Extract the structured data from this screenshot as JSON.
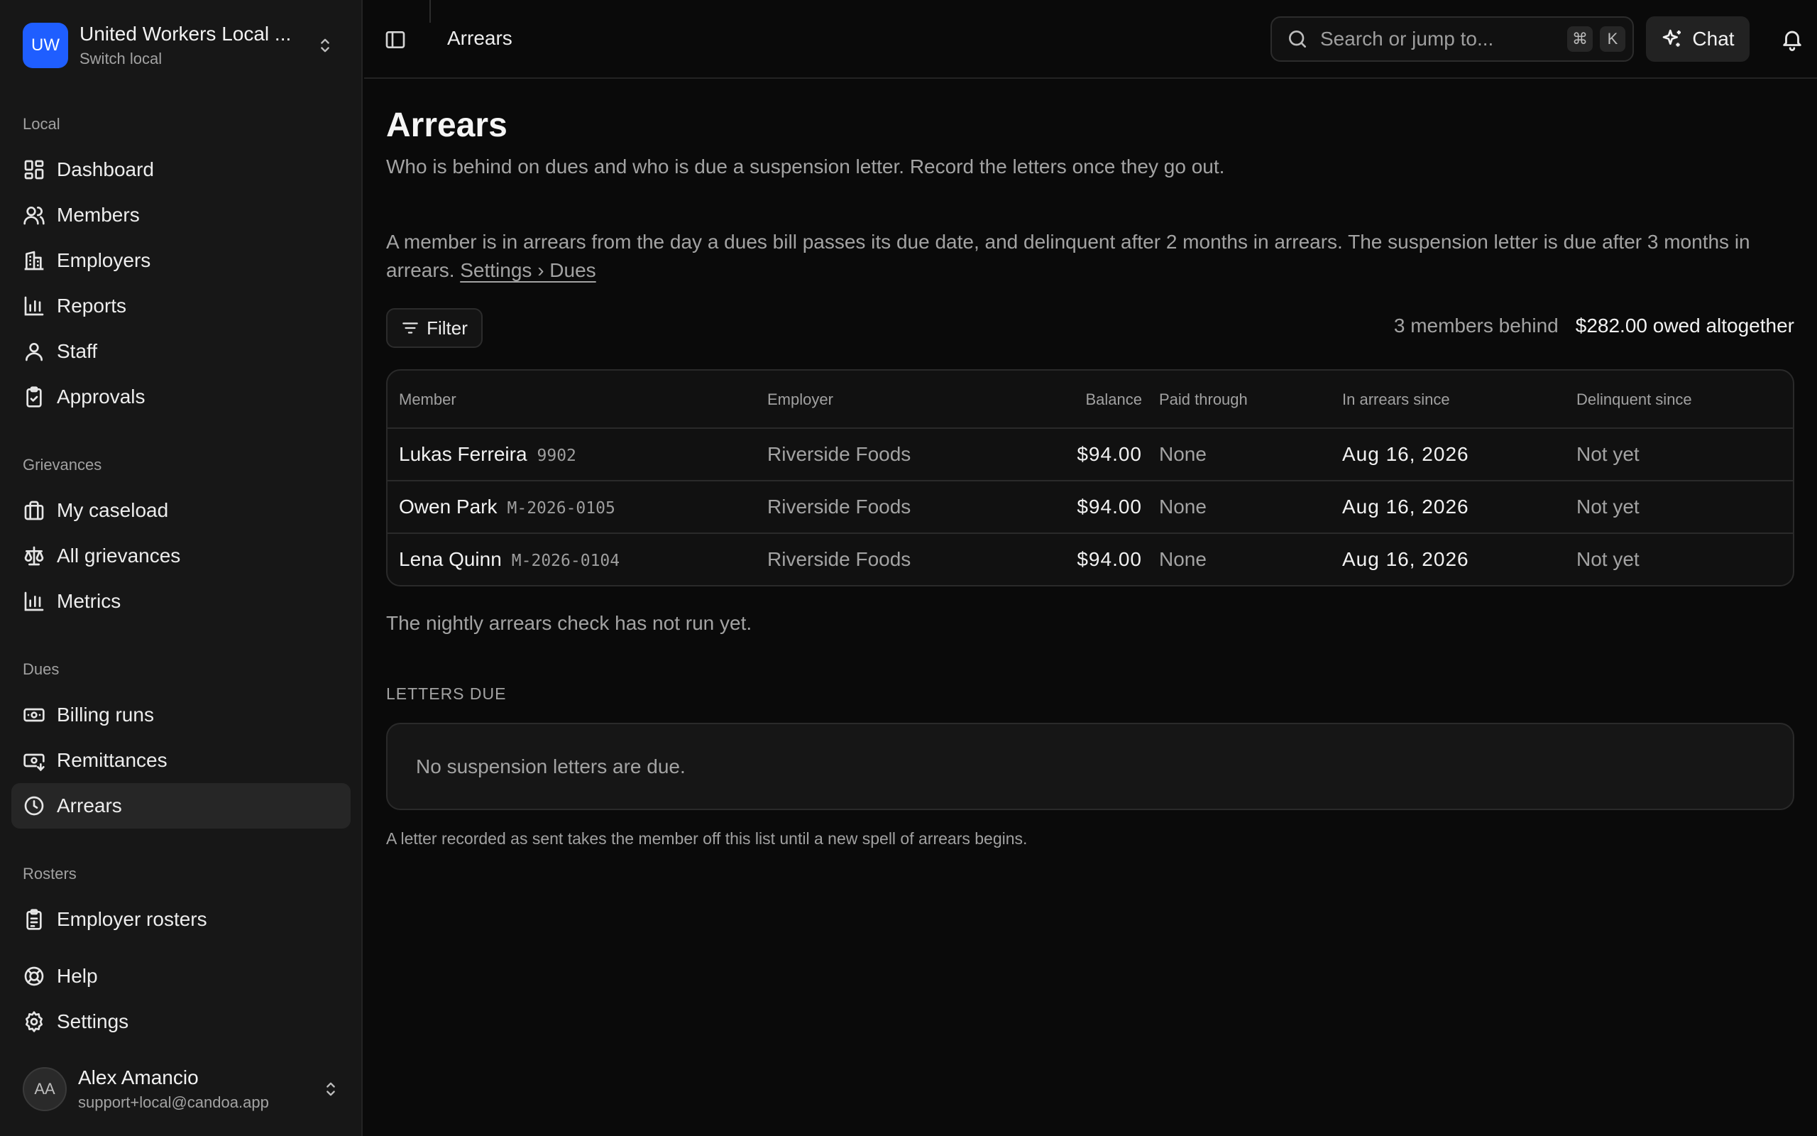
{
  "org": {
    "initials": "UW",
    "name": "United Workers Local ...",
    "sub": "Switch local"
  },
  "sidebar": {
    "sections": [
      {
        "label": "Local",
        "items": [
          "Dashboard",
          "Members",
          "Employers",
          "Reports",
          "Staff",
          "Approvals"
        ]
      },
      {
        "label": "Grievances",
        "items": [
          "My caseload",
          "All grievances",
          "Metrics"
        ]
      },
      {
        "label": "Dues",
        "items": [
          "Billing runs",
          "Remittances",
          "Arrears"
        ]
      },
      {
        "label": "Rosters",
        "items": [
          "Employer rosters"
        ]
      }
    ],
    "footer_items": [
      "Help",
      "Settings"
    ],
    "active": "Arrears"
  },
  "user": {
    "initials": "AA",
    "name": "Alex Amancio",
    "email": "support+local@candoa.app"
  },
  "header": {
    "title": "Arrears",
    "search_placeholder": "Search or jump to...",
    "kbd_cmd": "⌘",
    "kbd_k": "K",
    "chat_label": "Chat"
  },
  "page": {
    "title": "Arrears",
    "subtitle": "Who is behind on dues and who is due a suspension letter. Record the letters once they go out.",
    "explanation": "A member is in arrears from the day a dues bill passes its due date, and delinquent after 2 months in arrears. The suspension letter is due after 3 months in arrears.",
    "settings_link": "Settings › Dues",
    "filter_label": "Filter",
    "summary_behind": "3 members behind",
    "summary_owed": "$282.00 owed altogether"
  },
  "table": {
    "columns": [
      "Member",
      "Employer",
      "Balance",
      "Paid through",
      "In arrears since",
      "Delinquent since"
    ],
    "rows": [
      {
        "name": "Lukas Ferreira",
        "number": "9902",
        "employer": "Riverside Foods",
        "balance": "$94.00",
        "paid_through": "None",
        "arrears_since": "Aug 16, 2026",
        "delinquent_since": "Not yet"
      },
      {
        "name": "Owen Park",
        "number": "M-2026-0105",
        "employer": "Riverside Foods",
        "balance": "$94.00",
        "paid_through": "None",
        "arrears_since": "Aug 16, 2026",
        "delinquent_since": "Not yet"
      },
      {
        "name": "Lena Quinn",
        "number": "M-2026-0104",
        "employer": "Riverside Foods",
        "balance": "$94.00",
        "paid_through": "None",
        "arrears_since": "Aug 16, 2026",
        "delinquent_since": "Not yet"
      }
    ]
  },
  "nightly_note": "The nightly arrears check has not run yet.",
  "letters": {
    "heading": "LETTERS DUE",
    "empty": "No suspension letters are due.",
    "note": "A letter recorded as sent takes the member off this list until a new spell of arrears begins."
  },
  "colors": {
    "accent": "#1f5eff",
    "background": "#0a0a0a",
    "sidebar": "#171717"
  }
}
